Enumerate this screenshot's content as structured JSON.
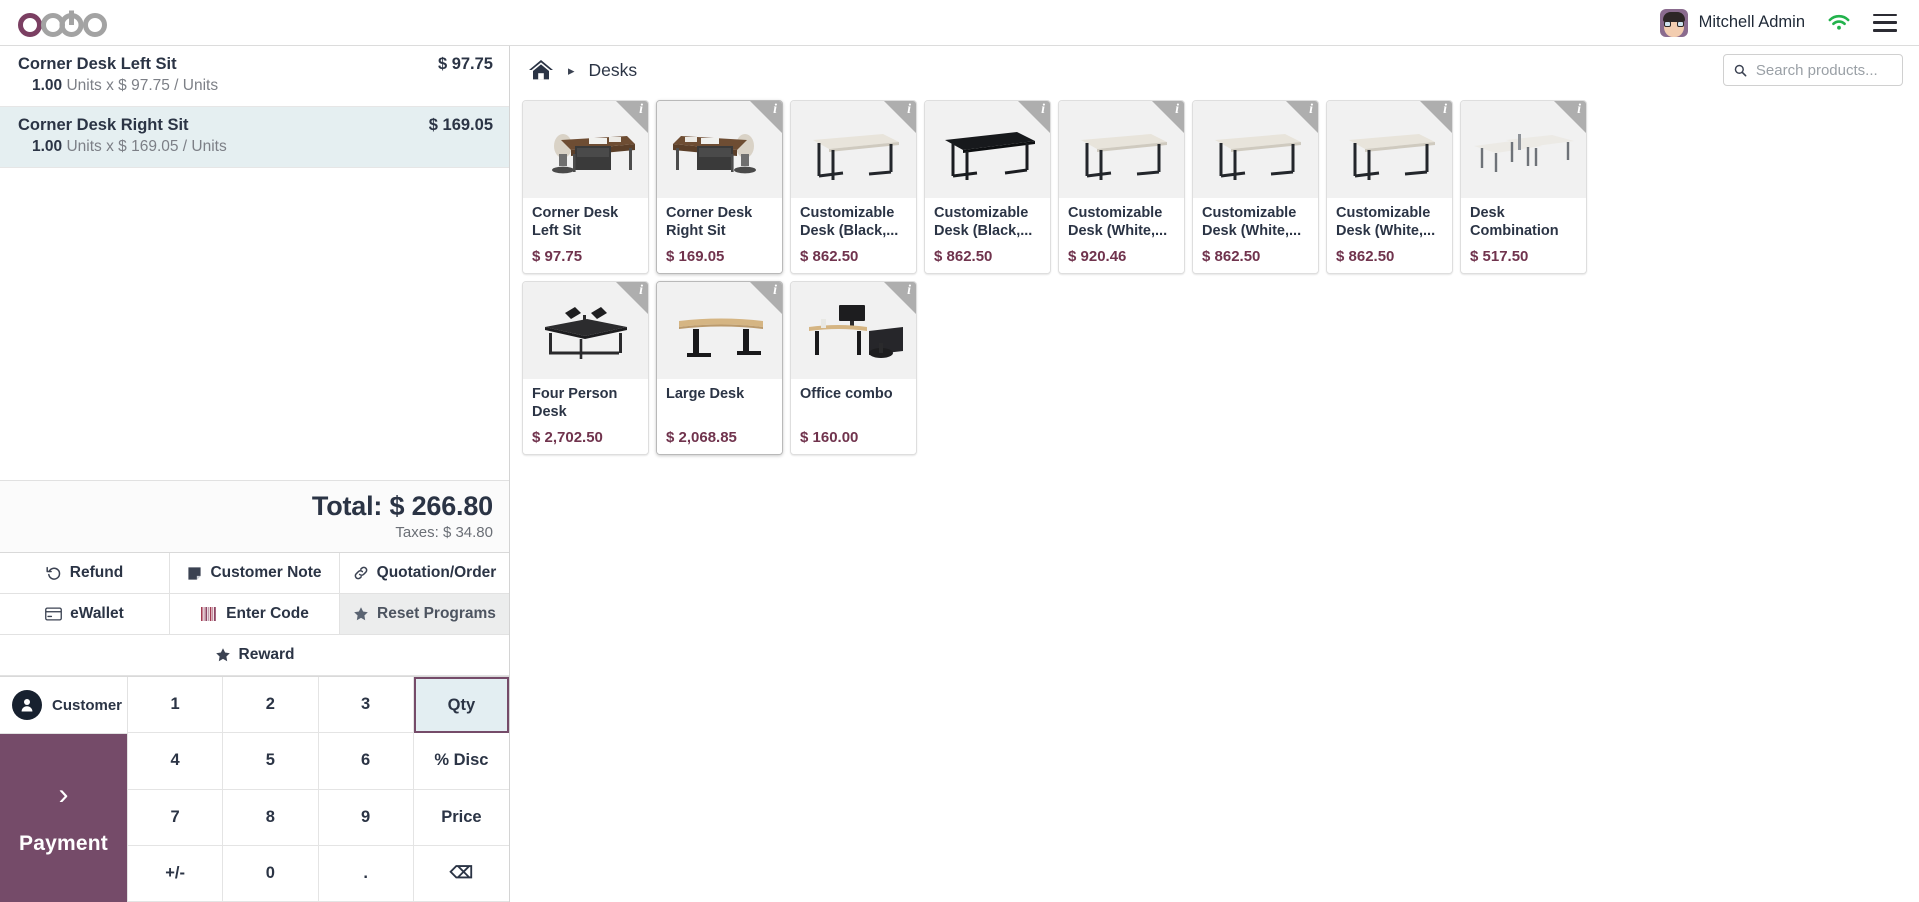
{
  "topbar": {
    "logo_text": "odoo",
    "user_name": "Mitchell Admin",
    "icons": {
      "wifi": "wifi-icon",
      "menu": "hamburger-menu-icon",
      "avatar": "user-avatar"
    }
  },
  "order": {
    "lines": [
      {
        "name": "Corner Desk Left Sit",
        "price": "$ 97.75",
        "qty": "1.00",
        "detail": "Units x $ 97.75 / Units",
        "selected": false
      },
      {
        "name": "Corner Desk Right Sit",
        "price": "$ 169.05",
        "qty": "1.00",
        "detail": "Units x $ 169.05 / Units",
        "selected": true
      }
    ],
    "total_label": "Total: $ 266.80",
    "taxes_label": "Taxes: $ 34.80"
  },
  "controls": {
    "refund": "Refund",
    "customer_note": "Customer Note",
    "quotation_order": "Quotation/Order",
    "ewallet": "eWallet",
    "enter_code": "Enter Code",
    "reset_programs": "Reset Programs",
    "reward": "Reward"
  },
  "payside": {
    "customer_label": "Customer",
    "payment_label": "Payment",
    "payment_chevron": "›"
  },
  "numpad": {
    "keys": [
      {
        "label": "1",
        "name": "numpad-1",
        "active": false
      },
      {
        "label": "2",
        "name": "numpad-2",
        "active": false
      },
      {
        "label": "3",
        "name": "numpad-3",
        "active": false
      },
      {
        "label": "Qty",
        "name": "numpad-qty",
        "active": true
      },
      {
        "label": "4",
        "name": "numpad-4",
        "active": false
      },
      {
        "label": "5",
        "name": "numpad-5",
        "active": false
      },
      {
        "label": "6",
        "name": "numpad-6",
        "active": false
      },
      {
        "label": "% Disc",
        "name": "numpad-discount",
        "active": false
      },
      {
        "label": "7",
        "name": "numpad-7",
        "active": false
      },
      {
        "label": "8",
        "name": "numpad-8",
        "active": false
      },
      {
        "label": "9",
        "name": "numpad-9",
        "active": false
      },
      {
        "label": "Price",
        "name": "numpad-price",
        "active": false
      },
      {
        "label": "+/-",
        "name": "numpad-plusminus",
        "active": false
      },
      {
        "label": "0",
        "name": "numpad-0",
        "active": false
      },
      {
        "label": ".",
        "name": "numpad-decimal",
        "active": false
      },
      {
        "label": "⌫",
        "name": "numpad-backspace",
        "active": false
      }
    ]
  },
  "catalog": {
    "breadcrumb_home": "home-icon",
    "breadcrumb_arrow": "▸",
    "breadcrumb_category": "Desks",
    "search_placeholder": "Search products...",
    "search_value": "",
    "rows": [
      [
        {
          "name": "Corner Desk Left Sit",
          "price": "$ 97.75",
          "img": "corner-desk-left",
          "highlight": false
        },
        {
          "name": "Corner Desk Right Sit",
          "price": "$ 169.05",
          "img": "corner-desk-right",
          "highlight": true
        },
        {
          "name": "Customizable Desk (Black,...",
          "price": "$ 862.50",
          "img": "desk-white-top-black-legs",
          "highlight": false
        },
        {
          "name": "Customizable Desk (Black,...",
          "price": "$ 862.50",
          "img": "desk-black",
          "highlight": false
        },
        {
          "name": "Customizable Desk (White,...",
          "price": "$ 920.46",
          "img": "desk-white-top-black-legs",
          "highlight": false
        },
        {
          "name": "Customizable Desk (White,...",
          "price": "$ 862.50",
          "img": "desk-white-top-black-legs",
          "highlight": false
        },
        {
          "name": "Customizable Desk (White,...",
          "price": "$ 862.50",
          "img": "desk-white-top-black-legs",
          "highlight": false
        },
        {
          "name": "Desk Combination",
          "price": "$ 517.50",
          "img": "desk-combination",
          "highlight": false
        }
      ],
      [
        {
          "name": "Four Person Desk",
          "price": "$ 2,702.50",
          "img": "four-person-desk",
          "highlight": false
        },
        {
          "name": "Large Desk",
          "price": "$ 2,068.85",
          "img": "large-desk",
          "highlight": true
        },
        {
          "name": "Office combo",
          "price": "$ 160.00",
          "img": "office-combo",
          "highlight": false
        }
      ]
    ],
    "info_badge": "i"
  },
  "colors": {
    "brand_purple": "#754b69",
    "price_maroon": "#70334d",
    "selected_row": "#e5eff1",
    "wifi_green": "#22b24c"
  }
}
